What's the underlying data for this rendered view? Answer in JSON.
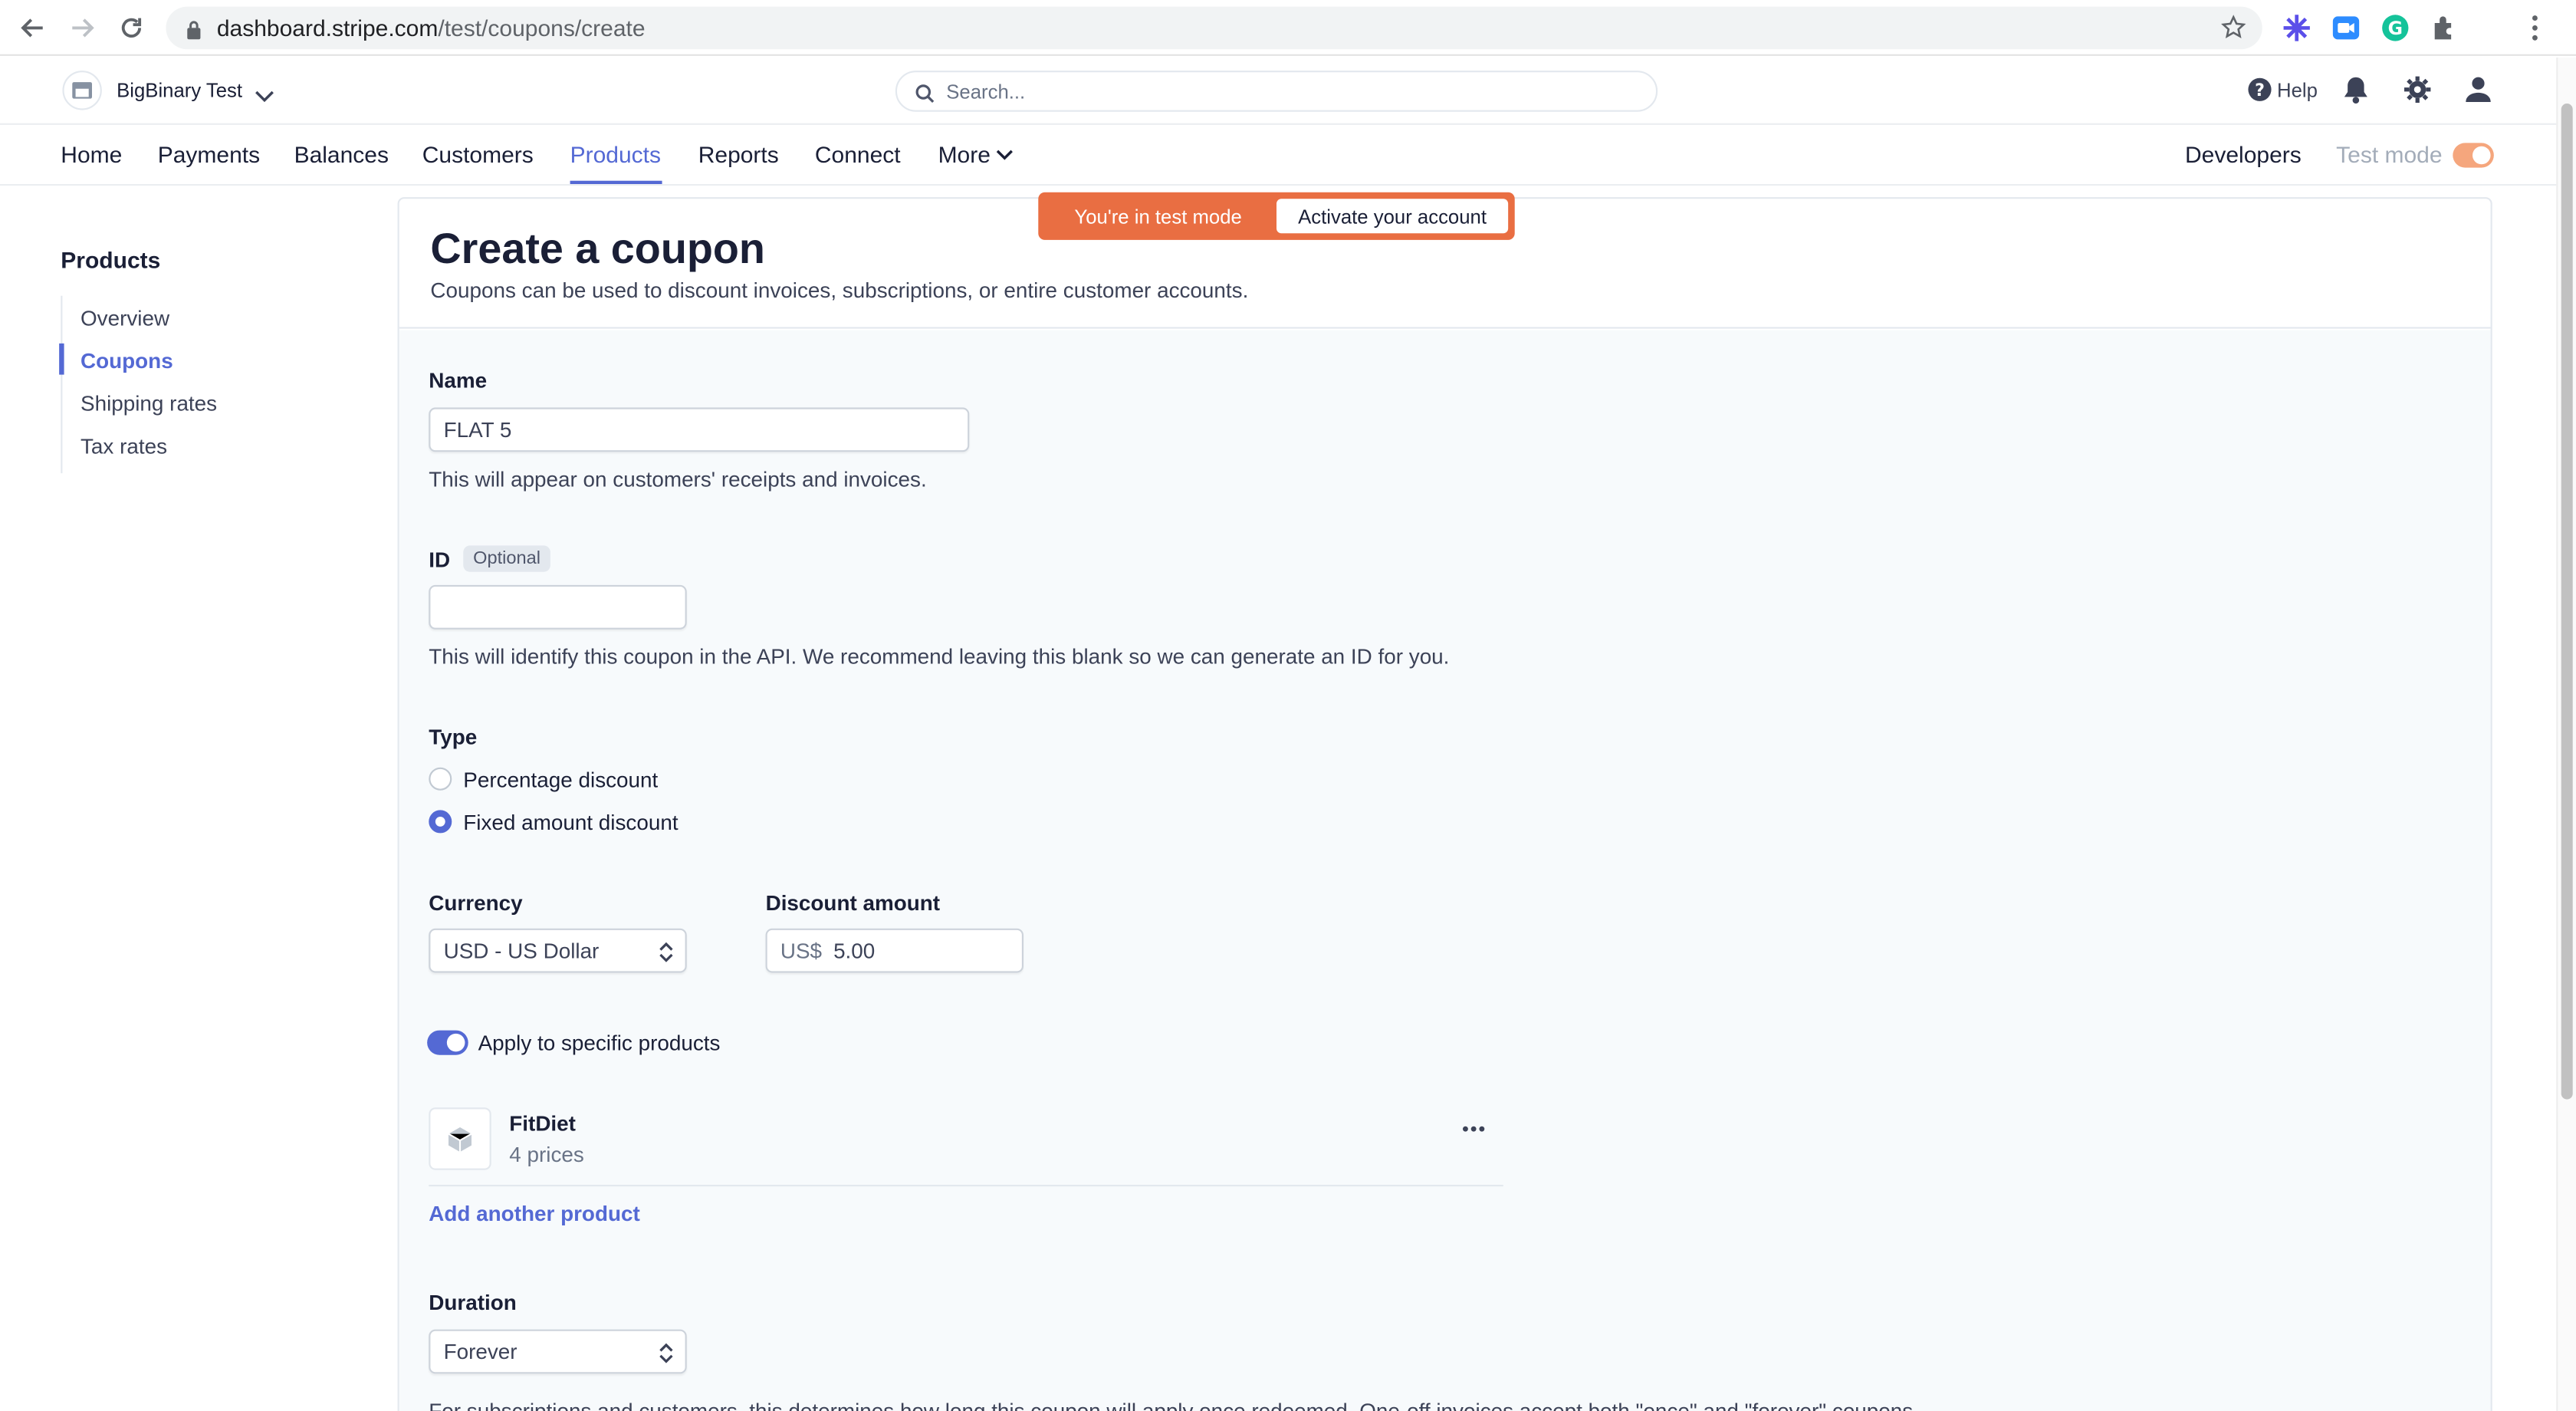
{
  "browser": {
    "url_host": "dashboard.stripe.com",
    "url_path": "/test/coupons/create"
  },
  "topbar": {
    "account_name": "BigBinary Test",
    "search_placeholder": "Search...",
    "help_label": "Help"
  },
  "nav": {
    "items": [
      "Home",
      "Payments",
      "Balances",
      "Customers",
      "Products",
      "Reports",
      "Connect",
      "More"
    ],
    "active": "Products",
    "developers": "Developers",
    "test_mode": "Test mode"
  },
  "banner": {
    "message": "You're in test mode",
    "action": "Activate your account"
  },
  "sidebar": {
    "title": "Products",
    "items": [
      "Overview",
      "Coupons",
      "Shipping rates",
      "Tax rates"
    ],
    "active": "Coupons"
  },
  "page": {
    "title": "Create a coupon",
    "subtitle": "Coupons can be used to discount invoices, subscriptions, or entire customer accounts."
  },
  "form": {
    "name_label": "Name",
    "name_value": "FLAT 5",
    "name_help": "This will appear on customers' receipts and invoices.",
    "id_label": "ID",
    "id_badge": "Optional",
    "id_value": "",
    "id_help": "This will identify this coupon in the API. We recommend leaving this blank so we can generate an ID for you.",
    "type_label": "Type",
    "type_options": [
      "Percentage discount",
      "Fixed amount discount"
    ],
    "type_selected": "Fixed amount discount",
    "currency_label": "Currency",
    "currency_value": "USD - US Dollar",
    "amount_label": "Discount amount",
    "amount_prefix": "US$",
    "amount_value": "5.00",
    "apply_label": "Apply to specific products",
    "apply_enabled": true,
    "product": {
      "name": "FitDiet",
      "prices": "4 prices"
    },
    "add_product": "Add another product",
    "duration_label": "Duration",
    "duration_value": "Forever",
    "duration_help": "For subscriptions and customers, this determines how long this coupon will apply once redeemed. One-off invoices accept both \"once\" and \"forever\" coupons."
  },
  "colors": {
    "accent": "#5469d4",
    "banner": "#e96e42",
    "test_toggle": "#f5a67d"
  }
}
